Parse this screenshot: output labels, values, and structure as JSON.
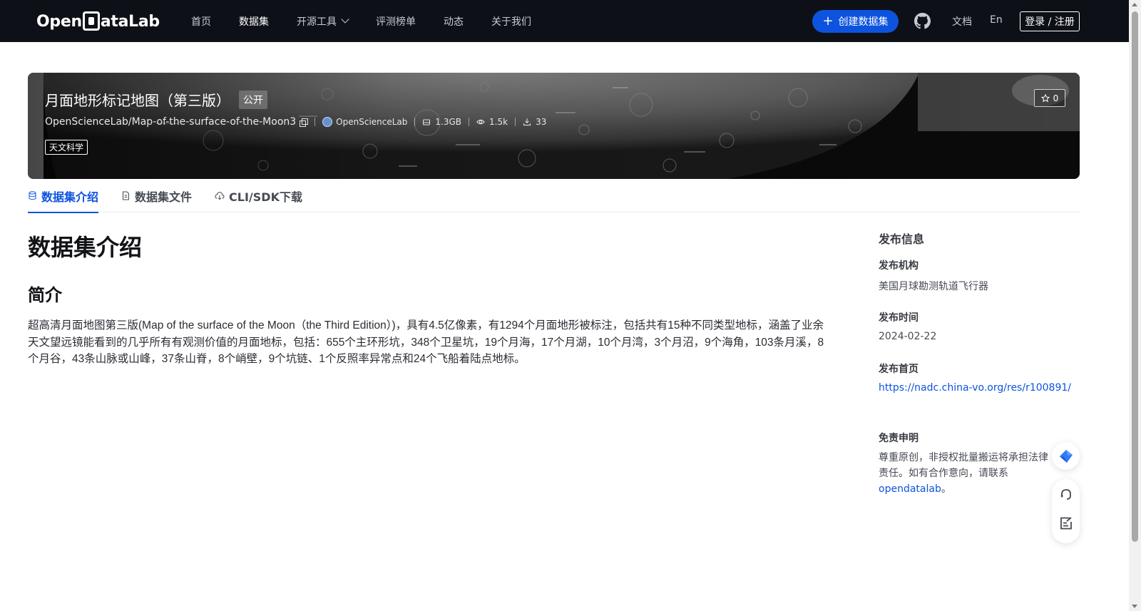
{
  "nav": {
    "logo_text_left": "Open",
    "logo_text_right": "ataLab",
    "links": [
      {
        "label": "首页",
        "active": false
      },
      {
        "label": "数据集",
        "active": true
      },
      {
        "label": "开源工具",
        "active": false,
        "dropdown": true
      },
      {
        "label": "评测榜单",
        "active": false
      },
      {
        "label": "动态",
        "active": false
      },
      {
        "label": "关于我们",
        "active": false
      }
    ],
    "create_button": "创建数据集",
    "github_icon": "github-icon",
    "docs": "文档",
    "lang": "En",
    "login": "登录 / 注册"
  },
  "dataset": {
    "title": "月面地形标记地图（第三版）",
    "visibility": "公开",
    "path": "OpenScienceLab/Map-of-the-surface-of-the-Moon3",
    "owner": "OpenScienceLab",
    "size": "1.3GB",
    "views": "1.5k",
    "downloads": "33",
    "tag": "天文科学",
    "stars": "0"
  },
  "tabs": [
    {
      "label": "数据集介绍",
      "icon": "database-icon",
      "active": true
    },
    {
      "label": "数据集文件",
      "icon": "file-icon",
      "active": false
    },
    {
      "label": "CLI/SDK下载",
      "icon": "cloud-download-icon",
      "active": false
    }
  ],
  "content": {
    "heading": "数据集介绍",
    "subheading": "简介",
    "description": "超高清月面地图第三版(Map of the surface of the Moon（the Third Edition）)，具有4.5亿像素，有1294个月面地形被标注，包括共有15种不同类型地标，涵盖了业余天文望远镜能看到的几乎所有有观测价值的月面地标，包括：655个主环形坑，348个卫星坑，19个月海，17个月湖，10个月湾，3个月沼，9个海角，103条月溪，8个月谷，43条山脉或山峰，37条山脊，8个峭壁，9个坑链、1个反照率异常点和24个飞船着陆点地标。"
  },
  "sidebar": {
    "title": "发布信息",
    "org_label": "发布机构",
    "org_value": "美国月球勘测轨道飞行器",
    "date_label": "发布时间",
    "date_value": "2024-02-22",
    "homepage_label": "发布首页",
    "homepage_value": "https://nadc.china-vo.org/res/r100891/",
    "disclaimer_label": "免责申明",
    "disclaimer_text_1": "尊重原创，非授权批量搬运将承担法律责任。如有合作意向，请联系",
    "disclaimer_link": "opendatalab",
    "disclaimer_text_2": "。"
  },
  "colors": {
    "nav_bg": "#0d1117",
    "accent": "#0d53de",
    "text_main": "#121316"
  }
}
